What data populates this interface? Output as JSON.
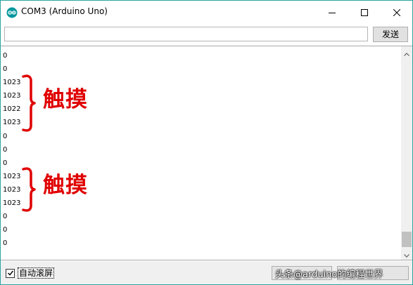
{
  "window": {
    "title": "COM3 (Arduino Uno)"
  },
  "input": {
    "value": "",
    "send_label": "发送"
  },
  "output": {
    "lines": [
      "0",
      "0",
      "1023",
      "1023",
      "1022",
      "1023",
      "0",
      "0",
      "0",
      "1023",
      "1023",
      "1023",
      "0",
      "0",
      "0"
    ]
  },
  "annotations": [
    {
      "label": "触摸",
      "color": "#e00000"
    },
    {
      "label": "触摸",
      "color": "#e00000"
    }
  ],
  "statusbar": {
    "autoscroll_label": "自动滚屏",
    "autoscroll_checked": true,
    "watermark": "头条@arduino的编程世界"
  },
  "colors": {
    "accent_border": "#2aa4a4",
    "annotation_red": "#e00000"
  },
  "icons": {
    "app": "arduino-logo-icon",
    "minimize": "minimize-icon",
    "maximize": "maximize-icon",
    "close": "close-icon"
  }
}
